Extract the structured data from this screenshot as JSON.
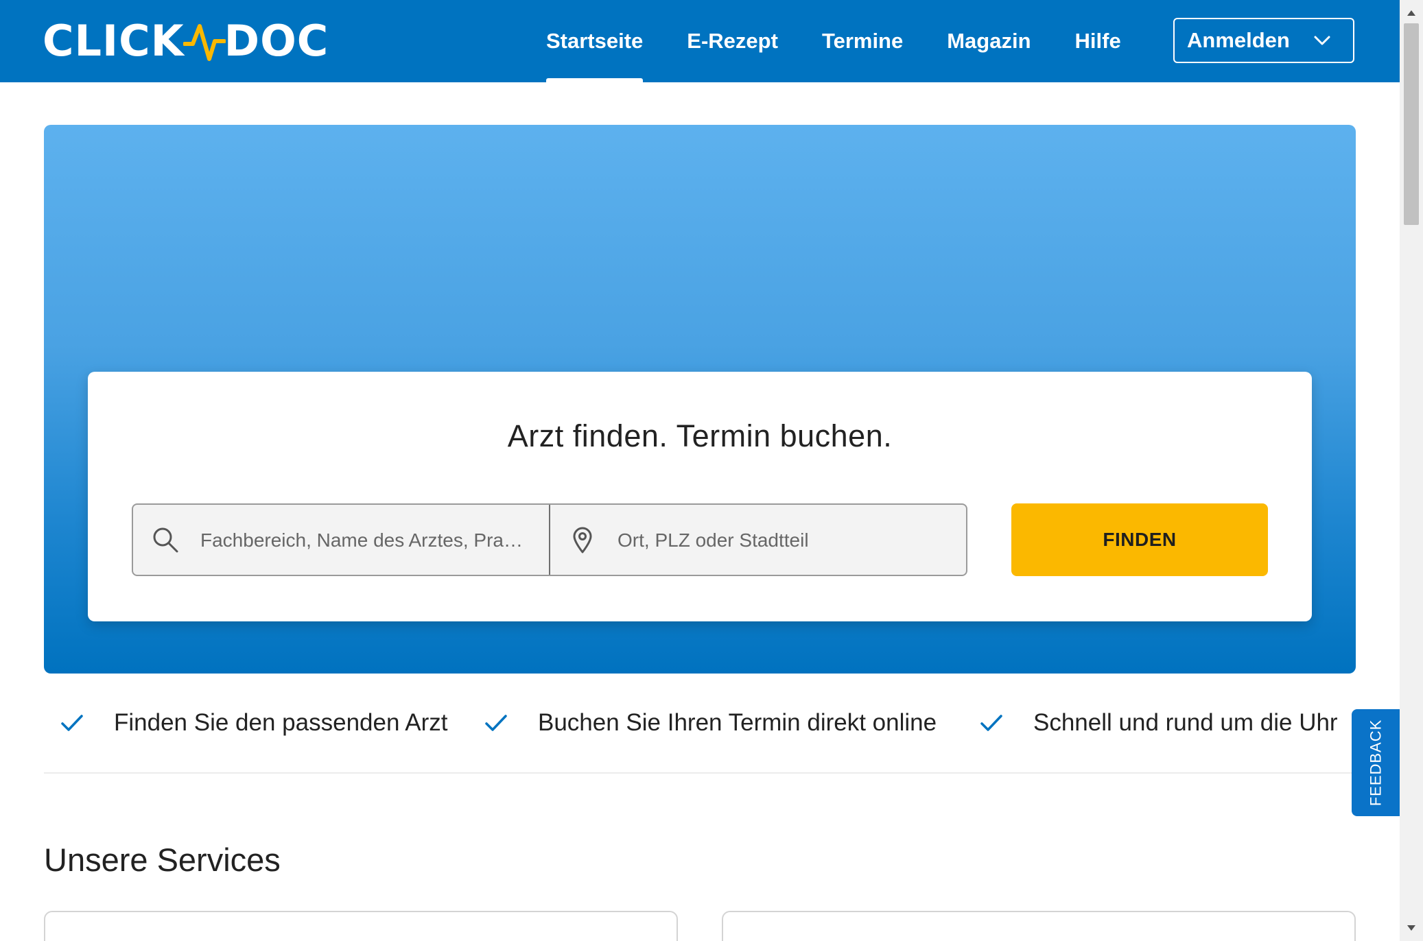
{
  "brand": {
    "logo_left": "CLICK",
    "logo_right": "DOC",
    "primary_color": "#0073c0",
    "accent_color": "#fbb800",
    "logo_icon": "heartbeat-wave-icon"
  },
  "nav": {
    "items": [
      {
        "label": "Startseite",
        "active": true
      },
      {
        "label": "E-Rezept",
        "active": false
      },
      {
        "label": "Termine",
        "active": false
      },
      {
        "label": "Magazin",
        "active": false
      },
      {
        "label": "Hilfe",
        "active": false
      }
    ],
    "login_label": "Anmelden",
    "login_icon": "chevron-down-icon"
  },
  "hero": {
    "title": "Arzt finden. Termin buchen.",
    "search": {
      "what_placeholder": "Fachbereich, Name des Arztes, Pra…",
      "what_value": "",
      "what_icon": "search-icon",
      "where_placeholder": "Ort, PLZ oder Stadtteil",
      "where_value": "",
      "where_icon": "location-pin-icon"
    },
    "find_label": "FINDEN"
  },
  "benefits": {
    "icon": "checkmark-icon",
    "items": [
      "Finden Sie den passenden Arzt",
      "Buchen Sie Ihren Termin direkt online",
      "Schnell und rund um die Uhr"
    ]
  },
  "services": {
    "title": "Unsere Services"
  },
  "feedback": {
    "label": "FEEDBACK"
  }
}
